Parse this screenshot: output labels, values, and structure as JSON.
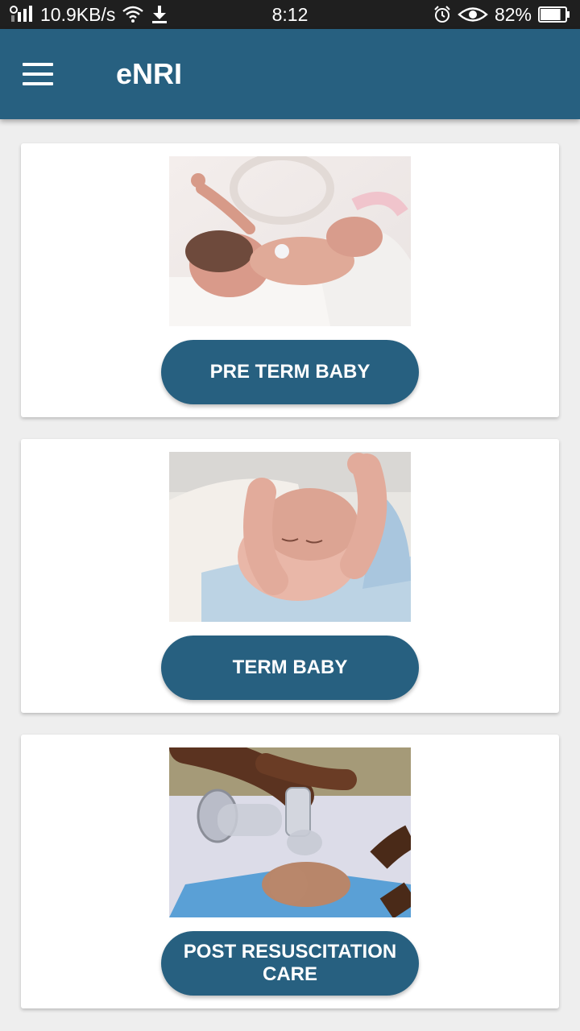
{
  "status_bar": {
    "speed": "10.9KB/s",
    "time": "8:12",
    "battery": "82%",
    "battery_level": 0.82
  },
  "app_bar": {
    "title": "eNRI"
  },
  "cards": [
    {
      "button_label": "PRE TERM BABY",
      "image": "preterm-baby-photo"
    },
    {
      "button_label": "TERM BABY",
      "image": "term-baby-photo"
    },
    {
      "button_label": "POST RESUSCITATION\nCARE",
      "image": "resuscitation-photo"
    }
  ],
  "colors": {
    "primary": "#276080",
    "background": "#eeeeee",
    "status_bar": "#1f1f1f"
  }
}
